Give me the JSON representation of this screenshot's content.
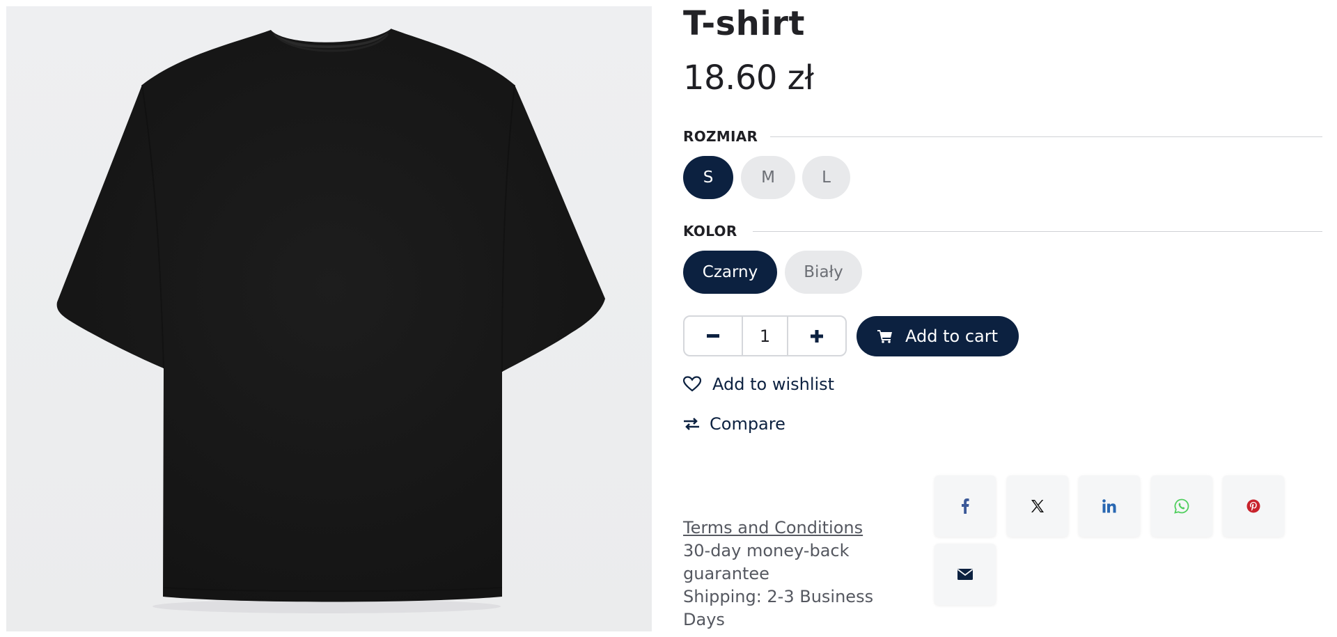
{
  "product": {
    "title": "T-shirt",
    "price": "18.60 zł",
    "image_icon": "tshirt-image"
  },
  "size": {
    "label": "ROZMIAR",
    "options": [
      "S",
      "M",
      "L"
    ],
    "selected": "S"
  },
  "color": {
    "label": "KOLOR",
    "options": [
      "Czarny",
      "Biały"
    ],
    "selected": "Czarny"
  },
  "quantity": {
    "value": "1",
    "minus_icon": "minus-icon",
    "plus_icon": "plus-icon"
  },
  "actions": {
    "add_to_cart": "Add to cart",
    "add_to_wishlist": "Add to wishlist",
    "compare": "Compare"
  },
  "info": {
    "terms": "Terms and Conditions",
    "guarantee": "30-day money-back guarantee",
    "shipping": "Shipping: 2-3 Business Days"
  },
  "share": [
    "facebook-icon",
    "x-icon",
    "linkedin-icon",
    "whatsapp-icon",
    "pinterest-icon",
    "email-icon"
  ],
  "colors": {
    "accent": "#0c2140",
    "pill_bg": "#e8e9eb",
    "facebook": "#3b5998",
    "linkedin": "#2867b2",
    "whatsapp": "#4fce5d",
    "pinterest": "#c8232c"
  }
}
